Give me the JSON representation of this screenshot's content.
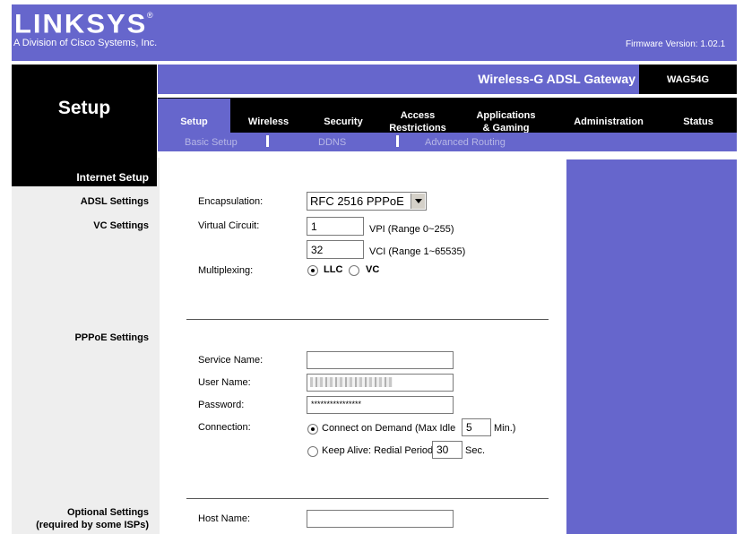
{
  "header": {
    "brand": "LINKSYS",
    "brand_reg": "®",
    "brand_sub": "A Division of Cisco Systems, Inc.",
    "firmware": "Firmware Version: 1.02.1"
  },
  "product": {
    "name": "Wireless-G ADSL Gateway",
    "model": "WAG54G"
  },
  "page_title": "Setup",
  "tabs": [
    {
      "label": "Setup"
    },
    {
      "label": "Wireless"
    },
    {
      "label": "Security"
    },
    {
      "label": "Access\nRestrictions"
    },
    {
      "label": "Applications\n& Gaming"
    },
    {
      "label": "Administration"
    },
    {
      "label": "Status"
    }
  ],
  "subnav": [
    "Basic Setup",
    "DDNS",
    "Advanced Routing"
  ],
  "sections": {
    "internet_setup": "Internet Setup",
    "adsl": "ADSL Settings",
    "vc": "VC Settings",
    "pppoe": "PPPoE Settings",
    "optional_line1": "Optional Settings",
    "optional_line2": "(required by some ISPs)"
  },
  "form": {
    "encapsulation_label": "Encapsulation:",
    "encapsulation_value": "RFC 2516 PPPoE",
    "virtual_circuit_label": "Virtual Circuit:",
    "vpi_value": "1",
    "vpi_hint": "VPI (Range 0~255)",
    "vci_value": "32",
    "vci_hint": "VCI (Range 1~65535)",
    "multiplexing_label": "Multiplexing:",
    "mux_llc": "LLC",
    "mux_vc": "VC",
    "service_name_label": "Service Name:",
    "service_name_value": "",
    "user_name_label": "User Name:",
    "user_name_value": "",
    "password_label": "Password:",
    "password_value": "****************",
    "connection_label": "Connection:",
    "connect_on_demand": "Connect on Demand",
    "max_idle_label": "(Max Idle",
    "max_idle_value": "5",
    "max_idle_unit": "Min.)",
    "keep_alive": "Keep Alive: Redial Period",
    "redial_value": "30",
    "redial_unit": "Sec.",
    "host_name_label": "Host Name:",
    "host_name_value": ""
  },
  "colors": {
    "brand_purple": "#6666cc",
    "black": "#000000"
  }
}
